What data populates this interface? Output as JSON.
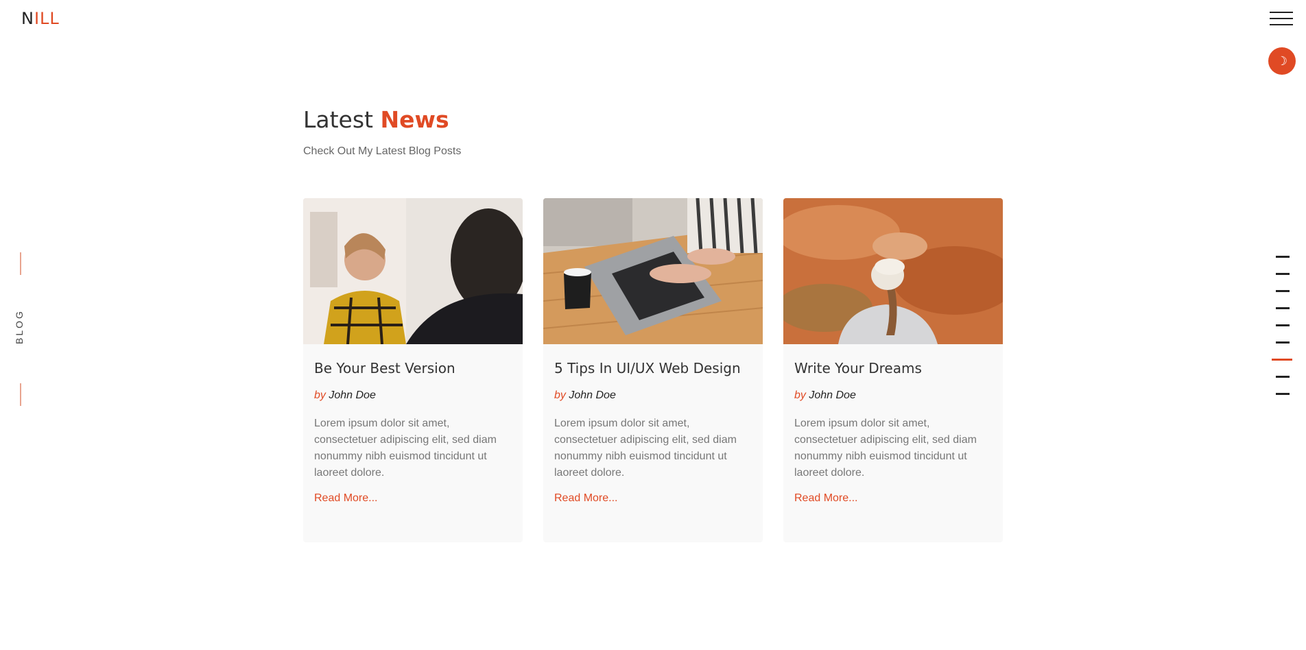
{
  "brand": {
    "logo_prefix": "N",
    "logo_accent": "ILL"
  },
  "theme_toggle_icon": "☽",
  "side_label": "BLOG",
  "section": {
    "title_plain": "Latest ",
    "title_accent": "News",
    "subtitle": "Check Out My Latest Blog Posts"
  },
  "posts": [
    {
      "title": "Be Your Best Version",
      "by": "by",
      "author": "John Doe",
      "excerpt": "Lorem ipsum dolor sit amet, consectetuer adipiscing elit, sed diam nonummy nibh euismod tincidunt ut laoreet dolore.",
      "read_more": "Read More..."
    },
    {
      "title": "5 Tips In UI/UX Web Design",
      "by": "by",
      "author": "John Doe",
      "excerpt": "Lorem ipsum dolor sit amet, consectetuer adipiscing elit, sed diam nonummy nibh euismod tincidunt ut laoreet dolore.",
      "read_more": "Read More..."
    },
    {
      "title": "Write Your Dreams",
      "by": "by",
      "author": "John Doe",
      "excerpt": "Lorem ipsum dolor sit amet, consectetuer adipiscing elit, sed diam nonummy nibh euismod tincidunt ut laoreet dolore.",
      "read_more": "Read More..."
    }
  ],
  "nav_dots": {
    "count": 9,
    "active_index": 6
  },
  "colors": {
    "accent": "#e04a24",
    "text": "#333333",
    "muted": "#777777"
  }
}
